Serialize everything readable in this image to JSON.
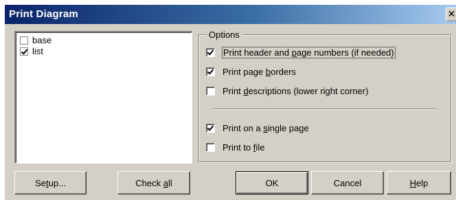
{
  "window": {
    "title": "Print Diagram",
    "close_glyph": "✕"
  },
  "diagram_list": {
    "items": [
      {
        "label": "base",
        "checked": false
      },
      {
        "label": "list",
        "checked": true
      }
    ]
  },
  "options": {
    "legend": "Options",
    "items": [
      {
        "pre": "Print header and ",
        "key": "p",
        "post": "age numbers (if needed)",
        "checked": true
      },
      {
        "pre": "Print page ",
        "key": "b",
        "post": "orders",
        "checked": true
      },
      {
        "pre": "Print ",
        "key": "d",
        "post": "escriptions (lower right corner)",
        "checked": false
      },
      {
        "pre": "Print on a ",
        "key": "s",
        "post": "ingle page",
        "checked": true
      },
      {
        "pre": "Print to ",
        "key": "f",
        "post": "ile",
        "checked": false
      }
    ]
  },
  "buttons": {
    "setup": {
      "pre": "Se",
      "key": "t",
      "post": "up..."
    },
    "check_all": {
      "pre": "Check ",
      "key": "a",
      "post": "ll"
    },
    "ok": {
      "label": "OK"
    },
    "cancel": {
      "label": "Cancel"
    },
    "help": {
      "pre": "",
      "key": "H",
      "post": "elp"
    }
  }
}
